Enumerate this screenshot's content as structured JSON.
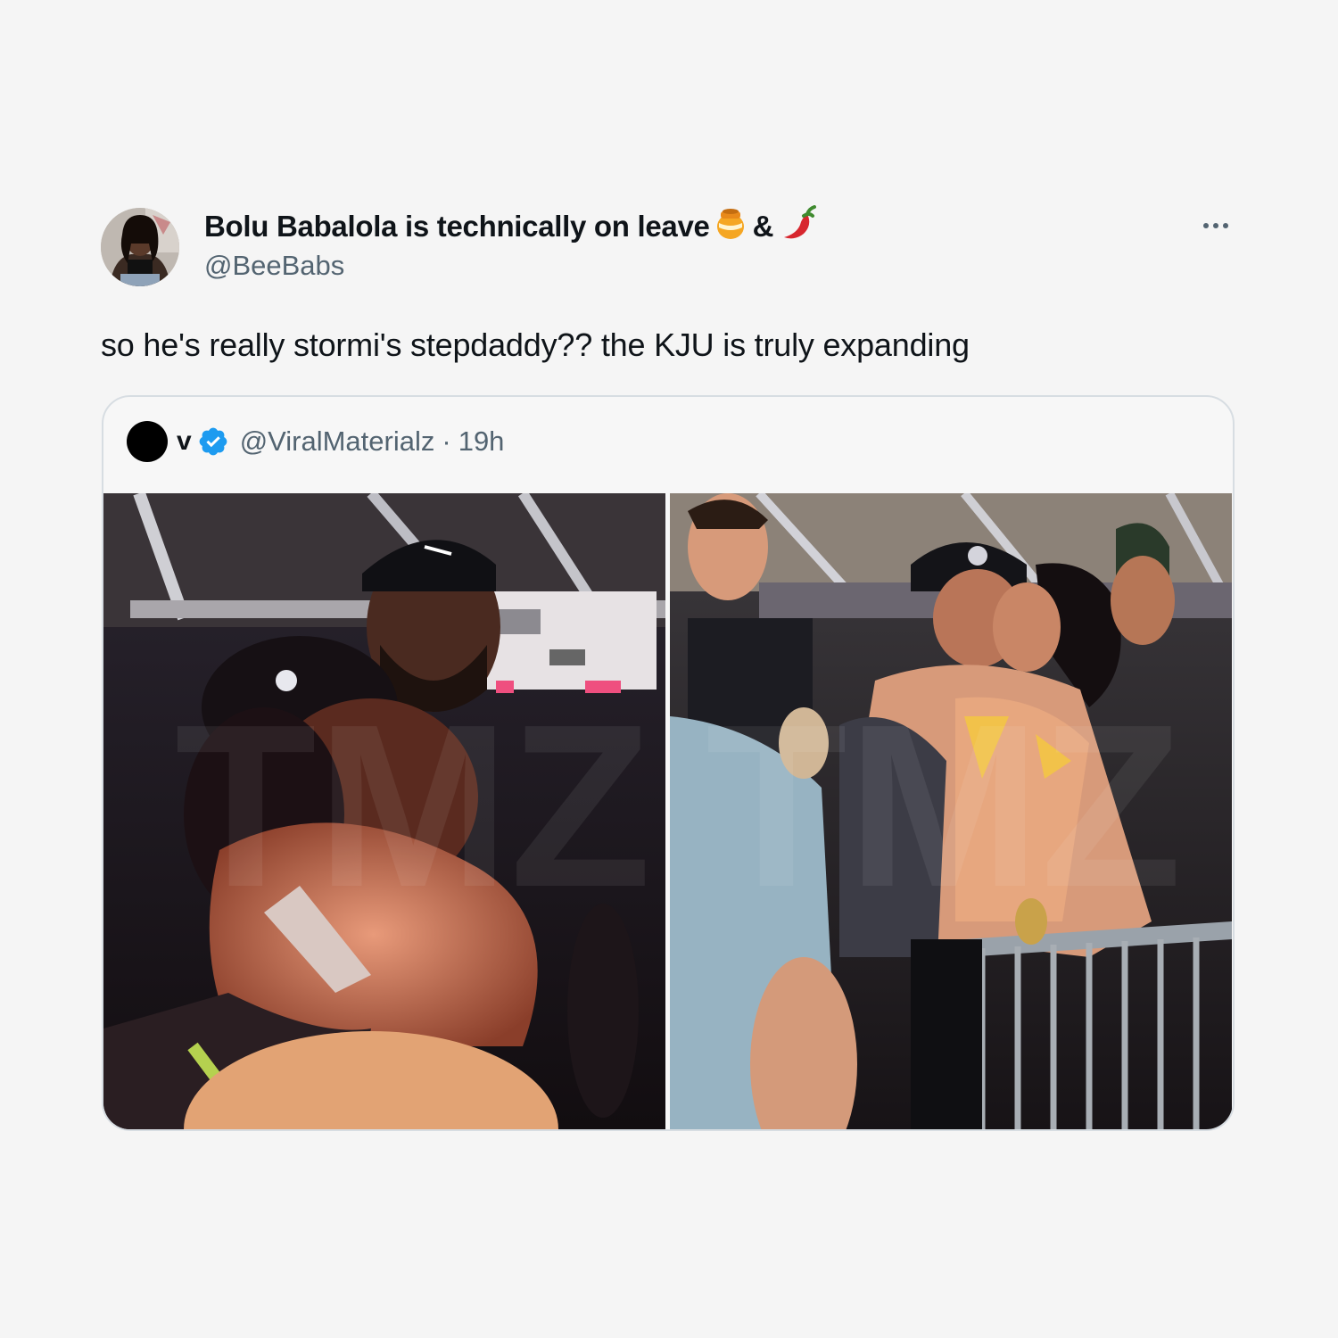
{
  "tweet": {
    "display_name": "Bolu Babalola is technically on leave",
    "name_separator": "&",
    "name_emojis": [
      "honey-pot-icon",
      "hot-pepper-icon"
    ],
    "handle": "@BeeBabs",
    "text": "so he's really stormi's stepdaddy?? the KJU is truly expanding",
    "more_icon": "more-dots-icon"
  },
  "quoted_tweet": {
    "name": "v",
    "verified_icon": "verified-badge-icon",
    "handle": "@ViralMaterialz",
    "separator": "·",
    "time": "19h",
    "media": [
      "photo-left",
      "photo-right"
    ]
  },
  "colors": {
    "background": "#f5f5f5",
    "text_primary": "#0f1419",
    "text_secondary": "#536471",
    "verified": "#1d9bf0",
    "border": "#d7dde2"
  }
}
